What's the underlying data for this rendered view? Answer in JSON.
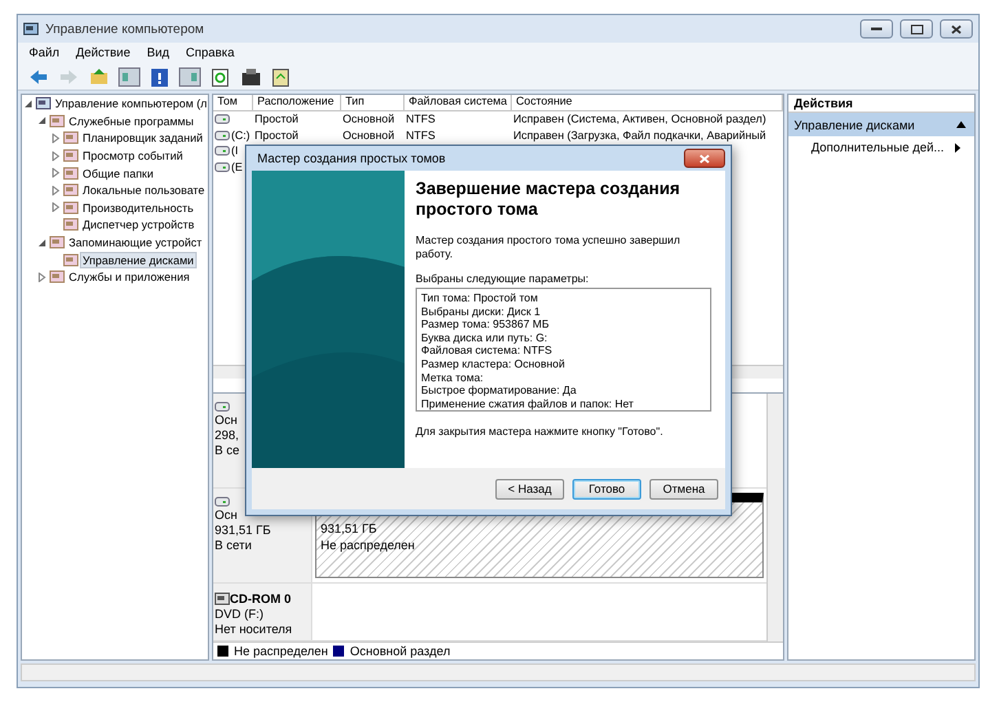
{
  "window": {
    "title": "Управление компьютером"
  },
  "menu": [
    "Файл",
    "Действие",
    "Вид",
    "Справка"
  ],
  "toolbar": [
    {
      "kind": "back",
      "disabled": false
    },
    {
      "kind": "forward",
      "disabled": true
    },
    {
      "kind": "up",
      "disabled": false
    },
    {
      "kind": "tree",
      "disabled": false
    },
    {
      "kind": "help",
      "disabled": false
    },
    {
      "kind": "pane",
      "disabled": false
    },
    {
      "kind": "refresh",
      "disabled": false
    },
    {
      "kind": "properties",
      "disabled": false
    },
    {
      "kind": "export",
      "disabled": false
    }
  ],
  "tree": [
    {
      "label": "Управление компьютером (л",
      "expanded": true,
      "selected": false,
      "children": [
        {
          "label": "Служебные программы",
          "expanded": true,
          "selected": false,
          "children": [
            {
              "label": "Планировщик заданий",
              "expanded": false,
              "selected": false
            },
            {
              "label": "Просмотр событий",
              "expanded": false,
              "selected": false
            },
            {
              "label": "Общие папки",
              "expanded": false,
              "selected": false
            },
            {
              "label": "Локальные пользовате",
              "expanded": false,
              "selected": false
            },
            {
              "label": "Производительность",
              "expanded": false,
              "selected": false
            },
            {
              "label": "Диспетчер устройств",
              "selected": false
            }
          ]
        },
        {
          "label": "Запоминающие устройст",
          "expanded": true,
          "selected": false,
          "children": [
            {
              "label": "Управление дисками",
              "selected": true
            }
          ]
        },
        {
          "label": "Службы и приложения",
          "expanded": false,
          "selected": false
        }
      ]
    }
  ],
  "table": {
    "columns": [
      "Том",
      "Расположение",
      "Тип",
      "Файловая система",
      "Состояние"
    ],
    "rows": [
      [
        "",
        "Простой",
        "Основной",
        "NTFS",
        "Исправен (Система, Активен, Основной раздел)"
      ],
      [
        "(C:)",
        "Простой",
        "Основной",
        "NTFS",
        "Исправен (Загрузка, Файл подкачки, Аварийный"
      ],
      [
        "(I",
        "",
        "",
        "",
        ""
      ],
      [
        "(E",
        "",
        "",
        "",
        ""
      ]
    ]
  },
  "disks": [
    {
      "kind": "disk",
      "lines": [
        "Осн",
        "298,",
        "В се"
      ]
    },
    {
      "kind": "disk",
      "lines": [
        "Осн",
        "931,51 ГБ",
        "В сети"
      ],
      "partition": {
        "kind": "unallocated",
        "size": "931,51 ГБ",
        "status": "Не распределен"
      }
    },
    {
      "kind": "cdrom",
      "title": "CD-ROM 0",
      "lines": [
        "DVD (F:)",
        "Нет носителя"
      ]
    }
  ],
  "legend": [
    {
      "label": "Не распределен",
      "color": "#000000"
    },
    {
      "label": "Основной раздел",
      "color": "#000080"
    }
  ],
  "actions": {
    "title": "Действия",
    "section": "Управление дисками",
    "items": [
      "Дополнительные дей..."
    ]
  },
  "dialog": {
    "title": "Мастер создания простых томов",
    "heading": "Завершение мастера создания простого тома",
    "intro": "Мастер создания простого тома успешно завершил работу.",
    "params_label": "Выбраны следующие параметры:",
    "params": [
      "Тип тома: Простой том",
      "Выбраны диски: Диск 1",
      "Размер тома: 953867 МБ",
      "Буква диска или путь: G:",
      "Файловая система: NTFS",
      "Размер кластера: Основной",
      "Метка тома:",
      "Быстрое форматирование: Да",
      "Применение сжатия файлов и папок: Нет"
    ],
    "footer": "Для закрытия мастера нажмите кнопку \"Готово\".",
    "buttons": [
      {
        "label": "< Назад",
        "default": false
      },
      {
        "label": "Готово",
        "default": true
      },
      {
        "label": "Отмена",
        "default": false
      }
    ]
  }
}
